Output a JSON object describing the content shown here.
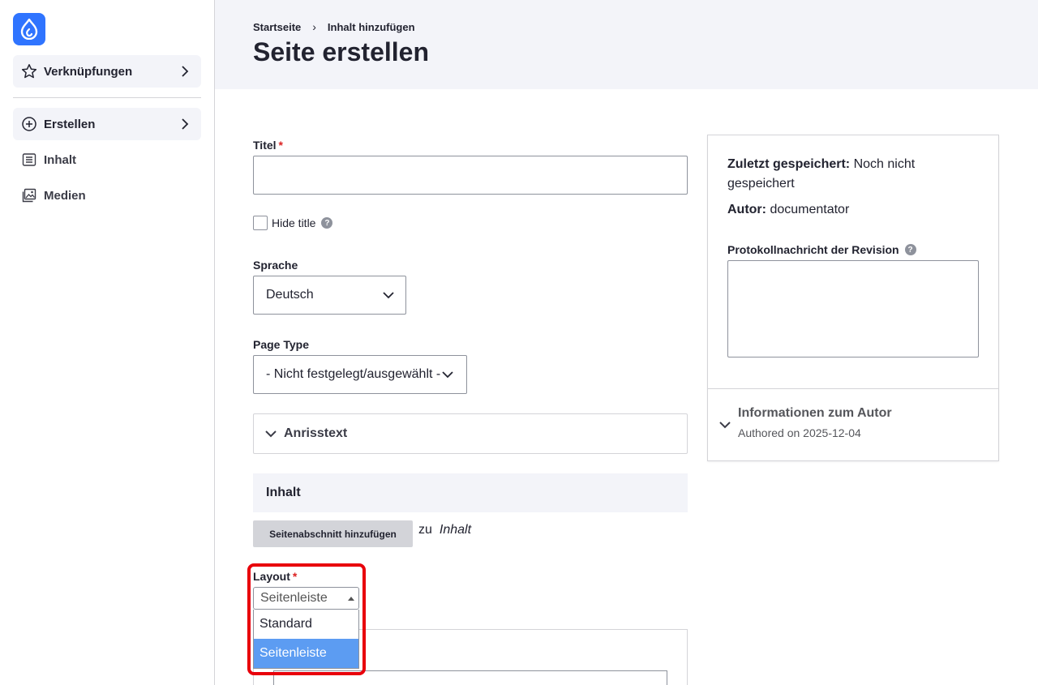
{
  "sidebar": {
    "logo_icon": "drupal-drop-icon",
    "shortcuts_label": "Verknüpfungen",
    "create_label": "Erstellen",
    "content_label": "Inhalt",
    "media_label": "Medien"
  },
  "header": {
    "breadcrumb": [
      "Startseite",
      "Inhalt hinzufügen"
    ],
    "title": "Seite erstellen"
  },
  "form": {
    "title_label": "Titel",
    "title_value": "",
    "hide_title_label": "Hide title",
    "language_label": "Sprache",
    "language_value": "Deutsch",
    "page_type_label": "Page Type",
    "page_type_value": "- Nicht festgelegt/ausgewählt -",
    "teaser_label": "Anrisstext",
    "content_section_label": "Inhalt",
    "add_section_button": "Seitenabschnitt hinzufügen",
    "add_to_text": "zu",
    "add_to_target": "Inhalt",
    "layout_label": "Layout",
    "layout_value": "Seitenleiste",
    "layout_options": [
      "Standard",
      "Seitenleiste"
    ],
    "layout_selected_option": "Seitenleiste",
    "required_marker": "*"
  },
  "meta": {
    "last_saved_label": "Zuletzt gespeichert:",
    "last_saved_value": "Noch nicht gespeichert",
    "author_label": "Autor:",
    "author_value": "documentator",
    "revision_log_label": "Protokollnachricht der Revision",
    "author_info_title": "Informationen zum Autor",
    "author_info_sub": "Authored on 2025-12-04"
  },
  "colors": {
    "accent": "#2f74ff",
    "highlight": "#e8000b",
    "selected_option": "#5c9cf2",
    "header_bg": "#f3f4f9"
  }
}
